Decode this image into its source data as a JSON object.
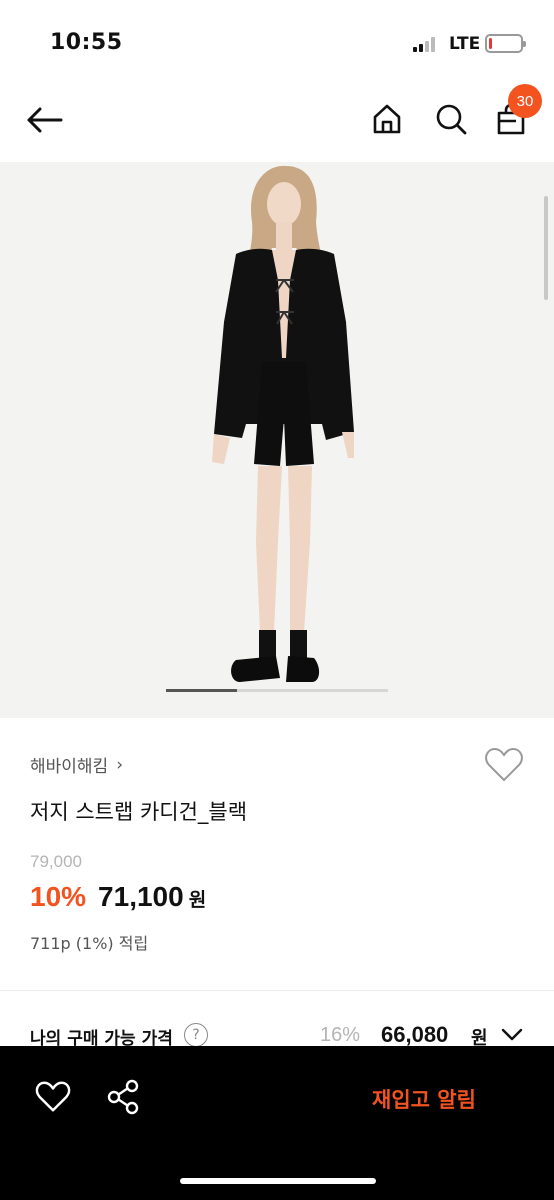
{
  "status_bar": {
    "time": "10:55",
    "network": "LTE",
    "battery_level": 0.08,
    "battery_color": "#e53935"
  },
  "header": {
    "back_icon": "arrow-left-icon",
    "home_icon": "home-icon",
    "search_icon": "search-icon",
    "cart_icon": "shopping-bag-icon",
    "cart_count": "30",
    "badge_color": "#f2531f"
  },
  "gallery": {
    "indicator_progress": 0.32,
    "image_alt": "black jersey strap cardigan on model"
  },
  "product": {
    "brand": "해바이해킴",
    "brand_chevron": "›",
    "name": "저지 스트랩 카디건_블랙",
    "original_price": "79,000",
    "discount": "10%",
    "sale_price": "71,100",
    "currency": "원",
    "points": "711p (1%) 적립"
  },
  "my_price": {
    "label": "나의 구매 가능 가격",
    "help_mark": "?",
    "discount": "16%",
    "price": "66,080",
    "currency": "원"
  },
  "bottom_bar": {
    "wish_icon": "heart-icon",
    "share_icon": "share-icon",
    "restock_label": "재입고 알림",
    "accent_color": "#f2531f"
  }
}
